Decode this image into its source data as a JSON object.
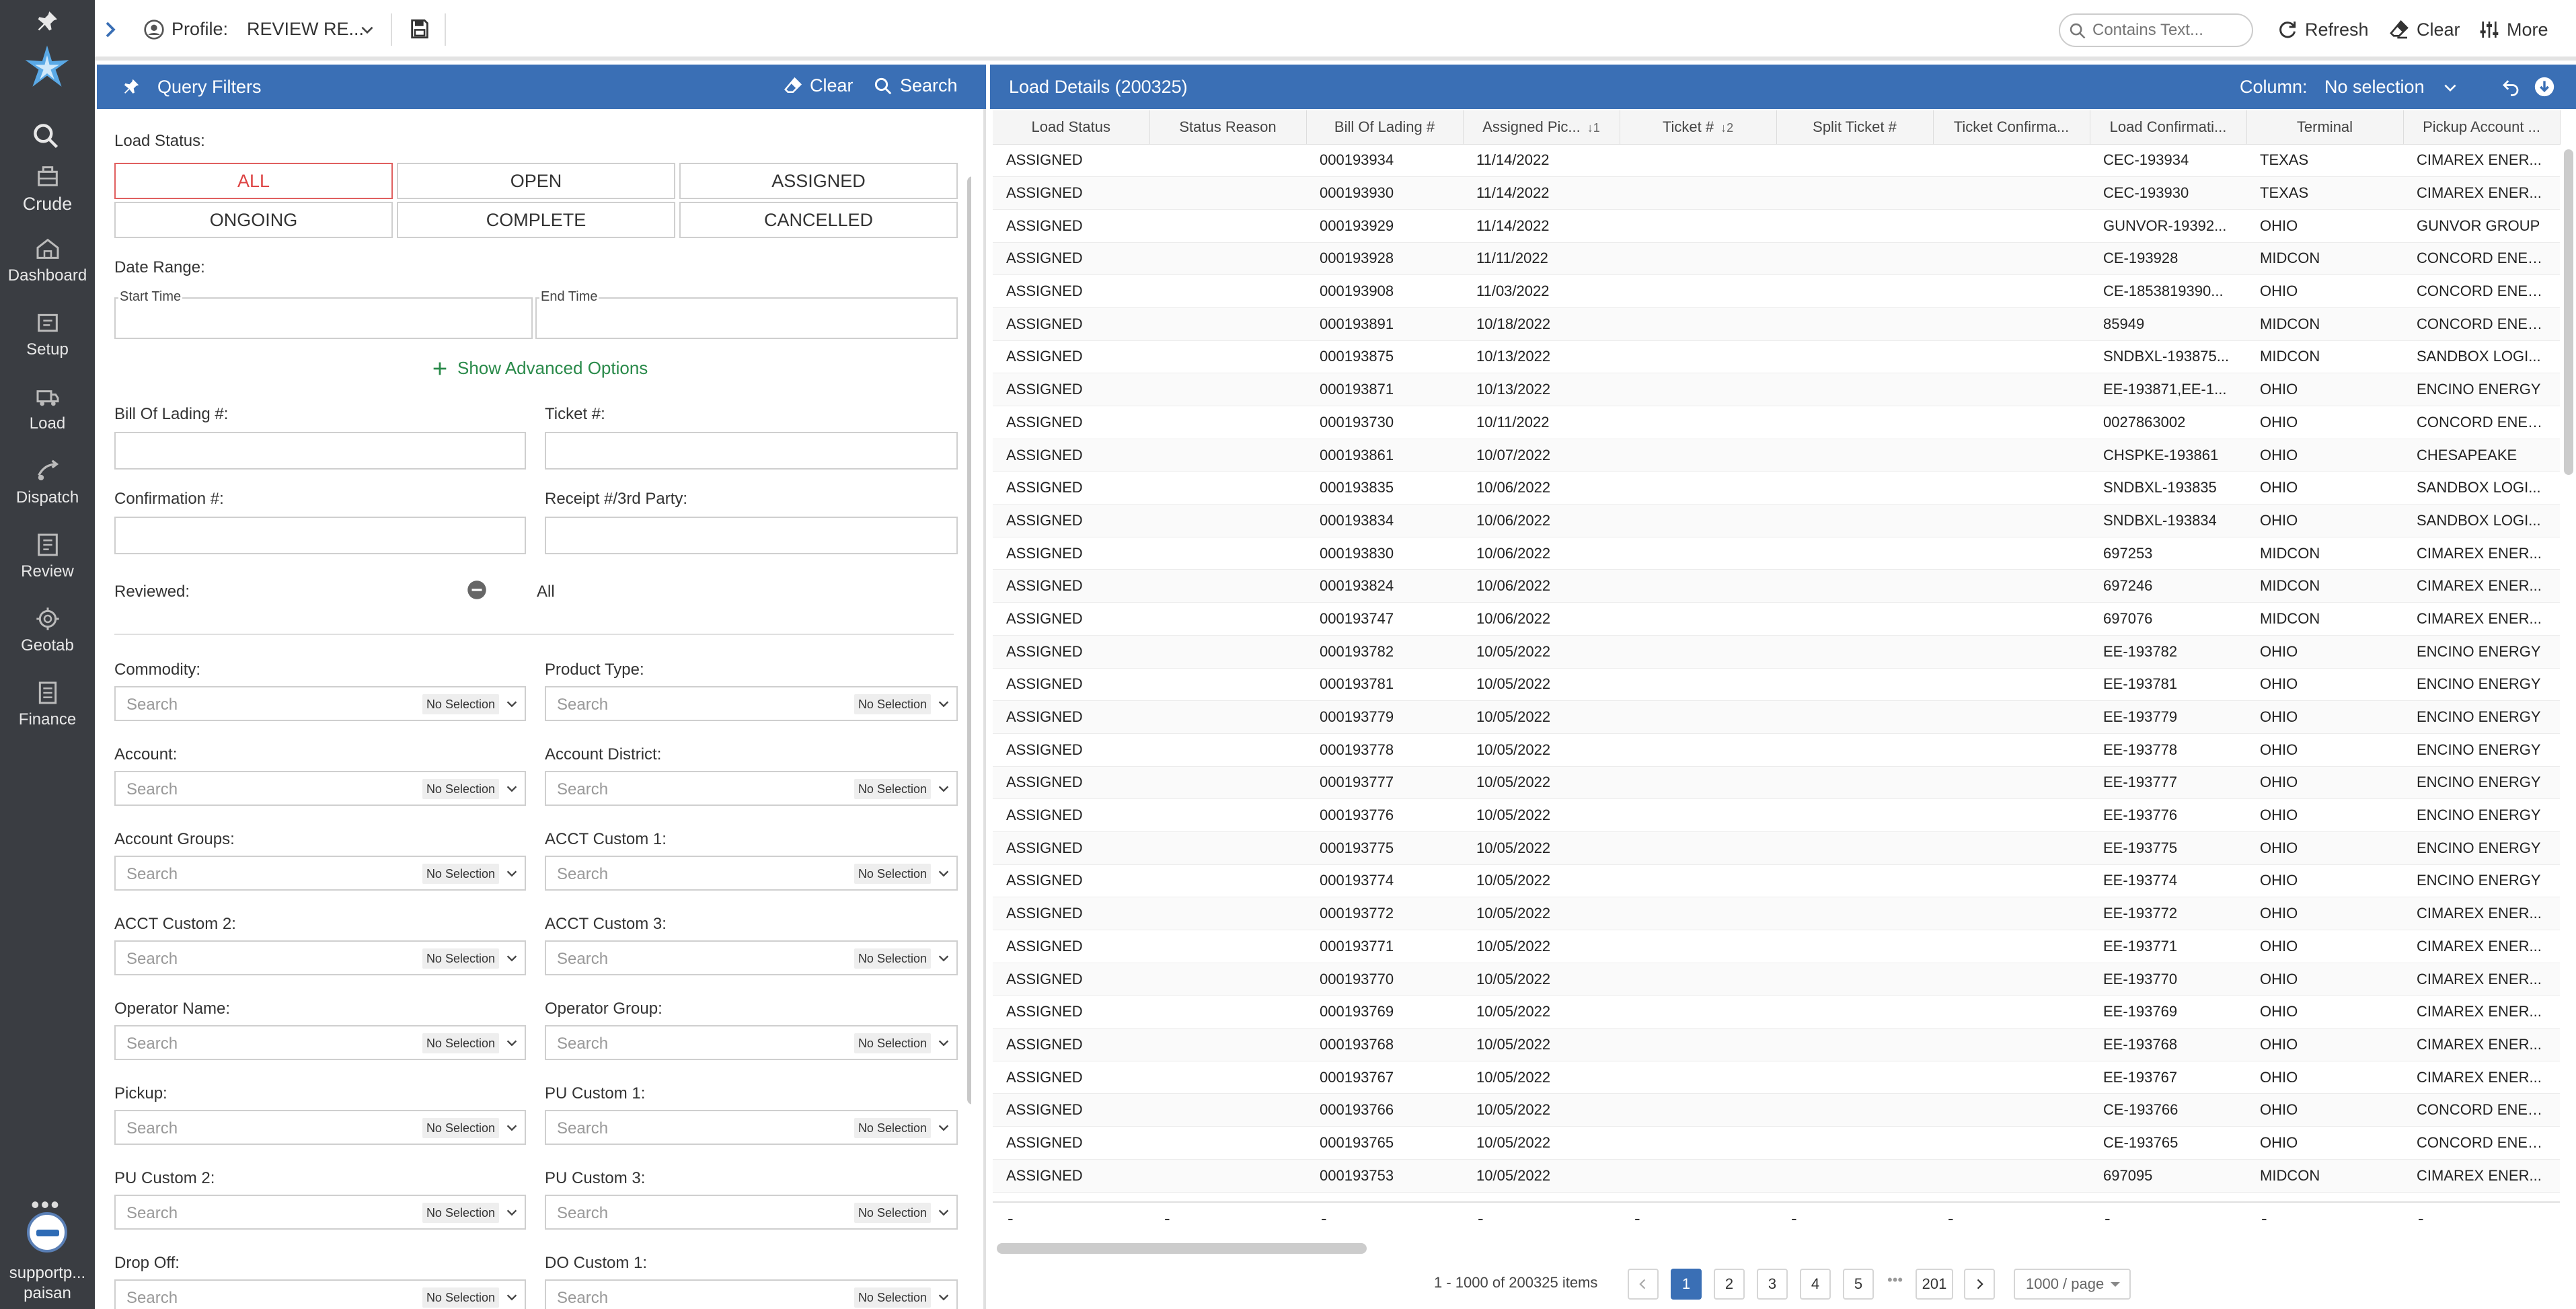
{
  "nav": {
    "items": [
      {
        "label": "Crude",
        "icon": "crude-icon"
      },
      {
        "label": "Dashboard",
        "icon": "dashboard-icon"
      },
      {
        "label": "Setup",
        "icon": "setup-icon"
      },
      {
        "label": "Load",
        "icon": "load-icon"
      },
      {
        "label": "Dispatch",
        "icon": "dispatch-icon"
      },
      {
        "label": "Review",
        "icon": "review-icon"
      },
      {
        "label": "Geotab",
        "icon": "geotab-icon"
      },
      {
        "label": "Finance",
        "icon": "finance-icon"
      }
    ],
    "more": "•••",
    "user_line1": "supportp...",
    "user_line2": "paisan"
  },
  "topbar": {
    "profile_label": "Profile:",
    "profile_value": "REVIEW RE...",
    "search_placeholder": "Contains Text...",
    "refresh": "Refresh",
    "clear": "Clear",
    "more": "More"
  },
  "query_filters": {
    "title": "Query Filters",
    "clear": "Clear",
    "search": "Search",
    "load_status_label": "Load Status:",
    "statuses": [
      "ALL",
      "OPEN",
      "ASSIGNED",
      "ONGOING",
      "COMPLETE",
      "CANCELLED"
    ],
    "active_status": "ALL",
    "date_range_label": "Date Range:",
    "start_time": "Start Time",
    "end_time": "End Time",
    "advanced": "Show Advanced Options",
    "bol_label": "Bill Of Lading #:",
    "ticket_label": "Ticket #:",
    "confirmation_label": "Confirmation #:",
    "receipt_label": "Receipt #/3rd Party:",
    "reviewed_label": "Reviewed:",
    "reviewed_value": "All",
    "search_placeholder": "Search",
    "no_selection": "No Selection",
    "multi_fields": [
      "Commodity:",
      "Product Type:",
      "Account:",
      "Account District:",
      "Account Groups:",
      "ACCT Custom 1:",
      "ACCT Custom 2:",
      "ACCT Custom 3:",
      "Operator Name:",
      "Operator Group:",
      "Pickup:",
      "PU Custom 1:",
      "PU Custom 2:",
      "PU Custom 3:",
      "Drop Off:",
      "DO Custom 1:"
    ]
  },
  "load_details": {
    "title": "Load Details (200325)",
    "column_label": "Column:",
    "column_value": "No selection",
    "columns": [
      "Load Status",
      "Status Reason",
      "Bill Of Lading #",
      "Assigned Pic...",
      "Ticket #",
      "Split Ticket #",
      "Ticket Confirma...",
      "Load Confirmati...",
      "Terminal",
      "Pickup Account ..."
    ],
    "sort_marks": [
      "",
      "",
      "",
      "↓1",
      "↓2",
      "",
      "",
      "",
      "",
      ""
    ],
    "rows": [
      [
        "ASSIGNED",
        "",
        "000193934",
        "11/14/2022",
        "",
        "",
        "",
        "CEC-193934",
        "TEXAS",
        "CIMAREX ENER..."
      ],
      [
        "ASSIGNED",
        "",
        "000193930",
        "11/14/2022",
        "",
        "",
        "",
        "CEC-193930",
        "TEXAS",
        "CIMAREX ENER..."
      ],
      [
        "ASSIGNED",
        "",
        "000193929",
        "11/14/2022",
        "",
        "",
        "",
        "GUNVOR-19392...",
        "OHIO",
        "GUNVOR GROUP"
      ],
      [
        "ASSIGNED",
        "",
        "000193928",
        "11/11/2022",
        "",
        "",
        "",
        "CE-193928",
        "MIDCON",
        "CONCORD ENER..."
      ],
      [
        "ASSIGNED",
        "",
        "000193908",
        "11/03/2022",
        "",
        "",
        "",
        "CE-1853819390...",
        "OHIO",
        "CONCORD ENER..."
      ],
      [
        "ASSIGNED",
        "",
        "000193891",
        "10/18/2022",
        "",
        "",
        "",
        "85949",
        "MIDCON",
        "CONCORD ENER..."
      ],
      [
        "ASSIGNED",
        "",
        "000193875",
        "10/13/2022",
        "",
        "",
        "",
        "SNDBXL-193875...",
        "MIDCON",
        "SANDBOX LOGI..."
      ],
      [
        "ASSIGNED",
        "",
        "000193871",
        "10/13/2022",
        "",
        "",
        "",
        "EE-193871,EE-1...",
        "OHIO",
        "ENCINO ENERGY"
      ],
      [
        "ASSIGNED",
        "",
        "000193730",
        "10/11/2022",
        "",
        "",
        "",
        "0027863002",
        "OHIO",
        "CONCORD ENER..."
      ],
      [
        "ASSIGNED",
        "",
        "000193861",
        "10/07/2022",
        "",
        "",
        "",
        "CHSPKE-193861",
        "OHIO",
        "CHESAPEAKE"
      ],
      [
        "ASSIGNED",
        "",
        "000193835",
        "10/06/2022",
        "",
        "",
        "",
        "SNDBXL-193835",
        "OHIO",
        "SANDBOX LOGI..."
      ],
      [
        "ASSIGNED",
        "",
        "000193834",
        "10/06/2022",
        "",
        "",
        "",
        "SNDBXL-193834",
        "OHIO",
        "SANDBOX LOGI..."
      ],
      [
        "ASSIGNED",
        "",
        "000193830",
        "10/06/2022",
        "",
        "",
        "",
        "697253",
        "MIDCON",
        "CIMAREX ENER..."
      ],
      [
        "ASSIGNED",
        "",
        "000193824",
        "10/06/2022",
        "",
        "",
        "",
        "697246",
        "MIDCON",
        "CIMAREX ENER..."
      ],
      [
        "ASSIGNED",
        "",
        "000193747",
        "10/06/2022",
        "",
        "",
        "",
        "697076",
        "MIDCON",
        "CIMAREX ENER..."
      ],
      [
        "ASSIGNED",
        "",
        "000193782",
        "10/05/2022",
        "",
        "",
        "",
        "EE-193782",
        "OHIO",
        "ENCINO ENERGY"
      ],
      [
        "ASSIGNED",
        "",
        "000193781",
        "10/05/2022",
        "",
        "",
        "",
        "EE-193781",
        "OHIO",
        "ENCINO ENERGY"
      ],
      [
        "ASSIGNED",
        "",
        "000193779",
        "10/05/2022",
        "",
        "",
        "",
        "EE-193779",
        "OHIO",
        "ENCINO ENERGY"
      ],
      [
        "ASSIGNED",
        "",
        "000193778",
        "10/05/2022",
        "",
        "",
        "",
        "EE-193778",
        "OHIO",
        "ENCINO ENERGY"
      ],
      [
        "ASSIGNED",
        "",
        "000193777",
        "10/05/2022",
        "",
        "",
        "",
        "EE-193777",
        "OHIO",
        "ENCINO ENERGY"
      ],
      [
        "ASSIGNED",
        "",
        "000193776",
        "10/05/2022",
        "",
        "",
        "",
        "EE-193776",
        "OHIO",
        "ENCINO ENERGY"
      ],
      [
        "ASSIGNED",
        "",
        "000193775",
        "10/05/2022",
        "",
        "",
        "",
        "EE-193775",
        "OHIO",
        "ENCINO ENERGY"
      ],
      [
        "ASSIGNED",
        "",
        "000193774",
        "10/05/2022",
        "",
        "",
        "",
        "EE-193774",
        "OHIO",
        "ENCINO ENERGY"
      ],
      [
        "ASSIGNED",
        "",
        "000193772",
        "10/05/2022",
        "",
        "",
        "",
        "EE-193772",
        "OHIO",
        "CIMAREX ENER..."
      ],
      [
        "ASSIGNED",
        "",
        "000193771",
        "10/05/2022",
        "",
        "",
        "",
        "EE-193771",
        "OHIO",
        "CIMAREX ENER..."
      ],
      [
        "ASSIGNED",
        "",
        "000193770",
        "10/05/2022",
        "",
        "",
        "",
        "EE-193770",
        "OHIO",
        "CIMAREX ENER..."
      ],
      [
        "ASSIGNED",
        "",
        "000193769",
        "10/05/2022",
        "",
        "",
        "",
        "EE-193769",
        "OHIO",
        "CIMAREX ENER..."
      ],
      [
        "ASSIGNED",
        "",
        "000193768",
        "10/05/2022",
        "",
        "",
        "",
        "EE-193768",
        "OHIO",
        "CIMAREX ENER..."
      ],
      [
        "ASSIGNED",
        "",
        "000193767",
        "10/05/2022",
        "",
        "",
        "",
        "EE-193767",
        "OHIO",
        "CIMAREX ENER..."
      ],
      [
        "ASSIGNED",
        "",
        "000193766",
        "10/05/2022",
        "",
        "",
        "",
        "CE-193766",
        "OHIO",
        "CONCORD ENER..."
      ],
      [
        "ASSIGNED",
        "",
        "000193765",
        "10/05/2022",
        "",
        "",
        "",
        "CE-193765",
        "OHIO",
        "CONCORD ENER..."
      ],
      [
        "ASSIGNED",
        "",
        "000193753",
        "10/05/2022",
        "",
        "",
        "",
        "697095",
        "MIDCON",
        "CIMAREX ENER..."
      ]
    ],
    "footer": [
      "-",
      "-",
      "-",
      "-",
      "-",
      "-",
      "-",
      "-",
      "-",
      "-"
    ],
    "pagination": {
      "range": "1 - 1000 of 200325 items",
      "pages": [
        "1",
        "2",
        "3",
        "4",
        "5"
      ],
      "dots": "•••",
      "last": "201",
      "per_page": "1000 / page",
      "current": "1"
    }
  },
  "colors": {
    "nav_bg": "#3a3d42",
    "header_blue": "#3a6fb5",
    "active_red": "#d44444",
    "advanced_green": "#2a8a4a"
  }
}
